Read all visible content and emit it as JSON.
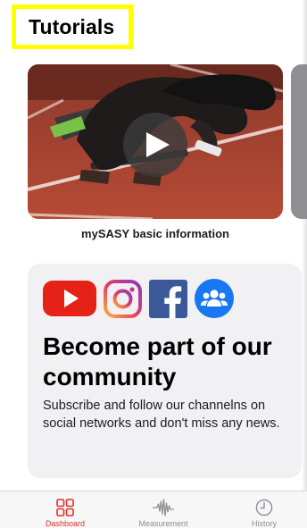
{
  "header": {
    "title": "Tutorials"
  },
  "tutorials": {
    "items": [
      {
        "caption": "mySASY basic information",
        "thumbnail": "sprinter-starting-blocks"
      }
    ],
    "play_icon": "play-icon"
  },
  "community": {
    "social_icons": [
      "youtube-icon",
      "instagram-icon",
      "facebook-icon",
      "community-group-icon"
    ],
    "heading": "Become part of our community",
    "body": "Subscribe and follow our channelns on social networks and don't miss any news."
  },
  "tabbar": {
    "tabs": [
      {
        "label": "Dashboard",
        "icon": "dashboard-grid-icon",
        "active": true
      },
      {
        "label": "Measurement",
        "icon": "waveform-icon",
        "active": false
      },
      {
        "label": "History",
        "icon": "clock-icon",
        "active": false
      }
    ]
  },
  "colors": {
    "accent": "#e0312a",
    "title_highlight": "#ffff00",
    "card_background": "#f1f1f3",
    "inactive_tab": "#8e8e93"
  }
}
